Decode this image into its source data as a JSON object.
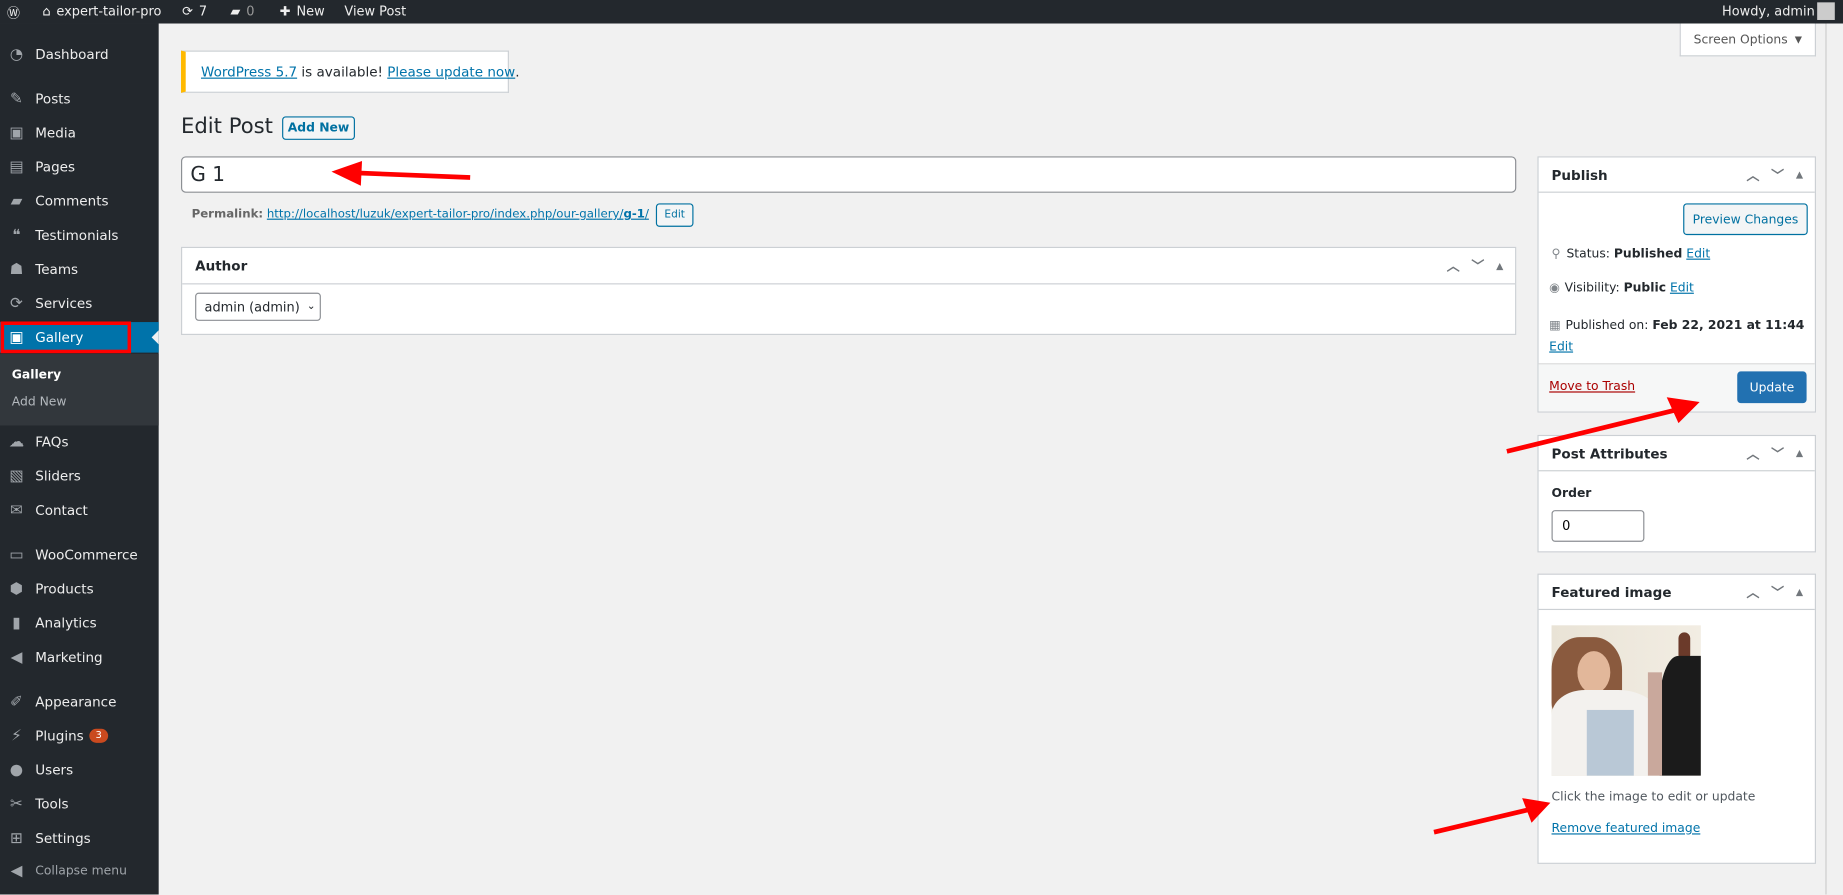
{
  "topbar": {
    "site": "expert-tailor-pro",
    "updates": "7",
    "comments": "0",
    "new": "New",
    "view_post": "View Post",
    "howdy": "Howdy, admin"
  },
  "sidebar": {
    "items": [
      {
        "label": "Dashboard",
        "icon": "dashboard-icon",
        "glyph": "◔"
      },
      {
        "label": "Posts",
        "icon": "pin-icon",
        "glyph": "✎"
      },
      {
        "label": "Media",
        "icon": "media-icon",
        "glyph": "▣"
      },
      {
        "label": "Pages",
        "icon": "pages-icon",
        "glyph": "▤"
      },
      {
        "label": "Comments",
        "icon": "comment-icon",
        "glyph": "▰"
      },
      {
        "label": "Testimonials",
        "icon": "testimonial-icon",
        "glyph": "❝"
      },
      {
        "label": "Teams",
        "icon": "groups-icon",
        "glyph": "☗"
      },
      {
        "label": "Services",
        "icon": "update-icon",
        "glyph": "⟳"
      },
      {
        "label": "Gallery",
        "icon": "gallery-icon",
        "glyph": "▣"
      },
      {
        "label": "FAQs",
        "icon": "chat-icon",
        "glyph": "☁"
      },
      {
        "label": "Sliders",
        "icon": "slides-icon",
        "glyph": "▧"
      },
      {
        "label": "Contact",
        "icon": "email-icon",
        "glyph": "✉"
      },
      {
        "label": "WooCommerce",
        "icon": "woo-icon",
        "glyph": "▭"
      },
      {
        "label": "Products",
        "icon": "archive-icon",
        "glyph": "⬢"
      },
      {
        "label": "Analytics",
        "icon": "chart-bar-icon",
        "glyph": "▮"
      },
      {
        "label": "Marketing",
        "icon": "megaphone-icon",
        "glyph": "◀"
      },
      {
        "label": "Appearance",
        "icon": "brush-icon",
        "glyph": "✐"
      },
      {
        "label": "Plugins",
        "icon": "plugin-icon",
        "glyph": "⚡",
        "badge": "3"
      },
      {
        "label": "Users",
        "icon": "users-icon",
        "glyph": "●"
      },
      {
        "label": "Tools",
        "icon": "wrench-icon",
        "glyph": "✂"
      },
      {
        "label": "Settings",
        "icon": "settings-icon",
        "glyph": "⊞"
      }
    ],
    "submenu": [
      "Gallery",
      "Add New"
    ],
    "collapse": "Collapse menu"
  },
  "screen_options": "Screen Options",
  "notice": {
    "link1": "WordPress 5.7",
    "text": " is available! ",
    "link2": "Please update now",
    "end": "."
  },
  "page": {
    "title": "Edit Post",
    "add_new": "Add New"
  },
  "post": {
    "title": "G 1",
    "permalink_label": "Permalink:",
    "permalink_base": "http://localhost/luzuk/expert-tailor-pro/index.php/our-gallery/",
    "permalink_slug": "g-1",
    "permalink_end": "/",
    "edit": "Edit"
  },
  "author": {
    "title": "Author",
    "value": "admin (admin)"
  },
  "publish": {
    "title": "Publish",
    "preview": "Preview Changes",
    "status_label": "Status: ",
    "status": "Published",
    "visibility_label": "Visibility: ",
    "visibility": "Public",
    "published_label": "Published on: ",
    "published": "Feb 22, 2021 at 11:44",
    "edit": "Edit",
    "trash": "Move to Trash",
    "update": "Update"
  },
  "attributes": {
    "title": "Post Attributes",
    "order_label": "Order",
    "order": "0"
  },
  "featured": {
    "title": "Featured image",
    "hint": "Click the image to edit or update",
    "remove": "Remove featured image"
  },
  "colors": {
    "accent": "#0073aa",
    "sidebar": "#23282d",
    "annotation": "#ff0000",
    "badge": "#ca4a1f"
  }
}
